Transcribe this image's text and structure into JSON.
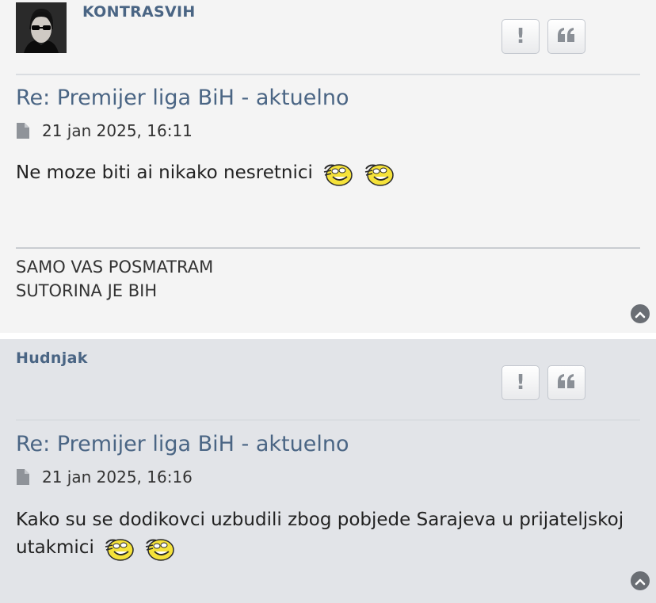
{
  "posts": [
    {
      "author": "KONTRASVIH",
      "title": "Re: Premijer liga BiH - aktuelno",
      "date": "21 jan 2025, 16:11",
      "content": "Ne moze biti ai nikako nesretnici",
      "signature_lines": [
        "SAMO VAS POSMATRAM",
        "SUTORINA JE BIH"
      ],
      "has_avatar": true
    },
    {
      "author": "Hudnjak",
      "title": "Re: Premijer liga BiH - aktuelno",
      "date": "21 jan 2025, 16:16",
      "content": "Kako su se dodikovci uzbudili zbog pobjede Sarajeva u prijateljskoj utakmici",
      "has_avatar": false
    }
  ],
  "buttons": {
    "report_symbol": "!",
    "quote_symbol": "“"
  },
  "icons": {
    "report": "exclamation-icon",
    "quote": "quote-icon",
    "post_link": "document-icon",
    "back_to_top": "chevron-up-icon",
    "emoticon": "laughing-smiley-icon"
  },
  "colors": {
    "username": "#4a6584",
    "title": "#4a6584",
    "post_bg_odd": "#f4f4f4",
    "post_bg_even": "#e2e4e8"
  }
}
